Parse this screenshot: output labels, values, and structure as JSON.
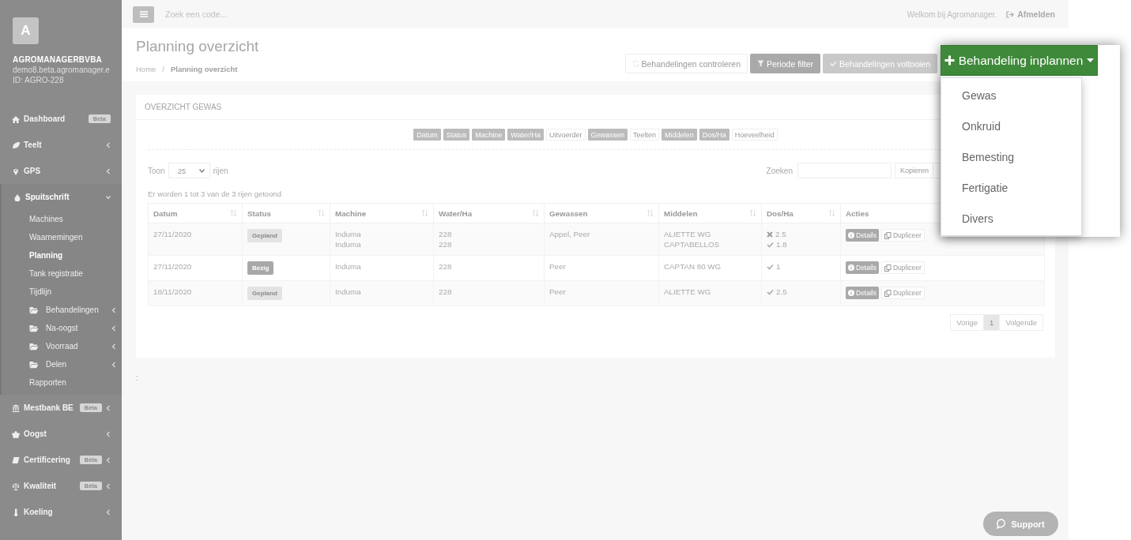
{
  "topbar": {
    "search": {
      "placeholder": "Zoek een code..."
    },
    "welcome": "Welkom bij Agromanager.",
    "logout": "Afmelden"
  },
  "sidebar": {
    "avatar": "A",
    "company": "AGROMANAGERBVBA",
    "domain": "demo8.beta.agromanager.e",
    "account_id": "ID: AGRO-228",
    "items": [
      {
        "label": "Dashboard",
        "badge": "Beta",
        "selected": false
      },
      {
        "label": "Teelt",
        "expanded": false,
        "selected": false
      },
      {
        "label": "GPS",
        "expanded": false,
        "selected": false
      },
      {
        "label": "Spuitschrift",
        "expanded": true,
        "selected": false,
        "children": [
          {
            "label": "Machines",
            "selected": false
          },
          {
            "label": "Waarnemingen",
            "selected": false
          },
          {
            "label": "Planning",
            "selected": true
          },
          {
            "label": "Tank registratie",
            "selected": false
          },
          {
            "label": "Tijdlijn",
            "selected": false
          },
          {
            "label": "Behandelingen",
            "kind": "folder",
            "expanded": false,
            "selected": false
          },
          {
            "label": "Na-oogst",
            "kind": "folder",
            "expanded": false,
            "selected": false
          },
          {
            "label": "Voorraad",
            "kind": "folder",
            "expanded": false,
            "selected": false
          },
          {
            "label": "Delen",
            "kind": "folder",
            "expanded": false,
            "selected": false
          },
          {
            "label": "Rapporten",
            "selected": false
          }
        ]
      },
      {
        "label": "Mestbank BE",
        "badge": "Bèta",
        "expanded": false,
        "selected": false
      },
      {
        "label": "Oogst",
        "expanded": false,
        "selected": false
      },
      {
        "label": "Certificering",
        "badge": "Bèta",
        "expanded": false,
        "selected": false
      },
      {
        "label": "Kwaliteit",
        "badge": "Bèta",
        "expanded": false,
        "selected": false
      },
      {
        "label": "Koeling",
        "expanded": false,
        "selected": false
      }
    ]
  },
  "page": {
    "title": "Planning overzicht",
    "breadcrumb": [
      {
        "label": "Home",
        "selected": false
      },
      {
        "label": "Planning overzicht",
        "selected": true
      }
    ],
    "breadcrumb_separator": "/",
    "actions": [
      {
        "kind": "outline",
        "label": "Behandelingen controleren",
        "disabled": false
      },
      {
        "kind": "filled",
        "label": "Periode filter",
        "disabled": false
      },
      {
        "kind": "filled",
        "label": "Behandelingen voltooien",
        "disabled": true
      }
    ],
    "primary_action": {
      "label": "Behandeling inplannen",
      "expanded": true,
      "menu": [
        "Gewas",
        "Onkruid",
        "Bemesting",
        "Fertigatie",
        "Divers"
      ]
    }
  },
  "card": {
    "title": "OVERZICHT GEWAS",
    "column_toggles": [
      {
        "label": "Datum",
        "on": true
      },
      {
        "label": "Status",
        "on": true
      },
      {
        "label": "Machine",
        "on": true
      },
      {
        "label": "Water/Ha",
        "on": true
      },
      {
        "label": "Uitvoerder",
        "on": false
      },
      {
        "label": "Gewassen",
        "on": true
      },
      {
        "label": "Teelten",
        "on": false
      },
      {
        "label": "Middelen",
        "on": true
      },
      {
        "label": "Dos/Ha",
        "on": true
      },
      {
        "label": "Hoeveelheid",
        "on": false
      }
    ],
    "length": {
      "prefix": "Toon",
      "value": "25",
      "suffix": "rijen"
    },
    "search": {
      "label": "Zoeken"
    },
    "buttons": [
      "Kopieren"
    ],
    "info": "Er worden 1 tot 3 van de 3 rijen getoond",
    "table": {
      "columns": [
        "Datum",
        "Status",
        "Machine",
        "Water/Ha",
        "Gewassen",
        "Middelen",
        "Dos/Ha",
        "Acties"
      ],
      "rows": [
        {
          "datum": "27/11/2020",
          "status": {
            "label": "Gepland",
            "color": "#e3e3e3"
          },
          "machine": [
            "Induma",
            "Induma"
          ],
          "water": [
            "228",
            "228"
          ],
          "gewassen": "Appel, Peer",
          "middelen": [
            "ALIETTE WG",
            "CAPTABELLOS"
          ],
          "dos": [
            {
              "value": "2.5",
              "ok": false
            },
            {
              "value": "1.8",
              "ok": true
            }
          ],
          "actions": [
            "Details",
            "Dupliceer"
          ]
        },
        {
          "datum": "27/11/2020",
          "status": {
            "label": "Bezig",
            "color": "#a8a8a8"
          },
          "machine": [
            "Induma"
          ],
          "water": [
            "228"
          ],
          "gewassen": "Peer",
          "middelen": [
            "CAPTAN 80 WG"
          ],
          "dos": [
            {
              "value": "1",
              "ok": true
            }
          ],
          "actions": [
            "Details",
            "Dupliceer"
          ]
        },
        {
          "datum": "18/11/2020",
          "status": {
            "label": "Gepland",
            "color": "#e3e3e3"
          },
          "machine": [
            "Induma"
          ],
          "water": [
            "228"
          ],
          "gewassen": "Peer",
          "middelen": [
            "ALIETTE WG"
          ],
          "dos": [
            {
              "value": "2.5",
              "ok": true
            }
          ],
          "actions": [
            "Details",
            "Dupliceer"
          ]
        }
      ]
    },
    "pagination": {
      "previous": "Vorige",
      "pages": [
        {
          "label": "1",
          "selected": true
        }
      ],
      "next": "Volgende"
    }
  },
  "footer_text": ":",
  "support": "Support"
}
